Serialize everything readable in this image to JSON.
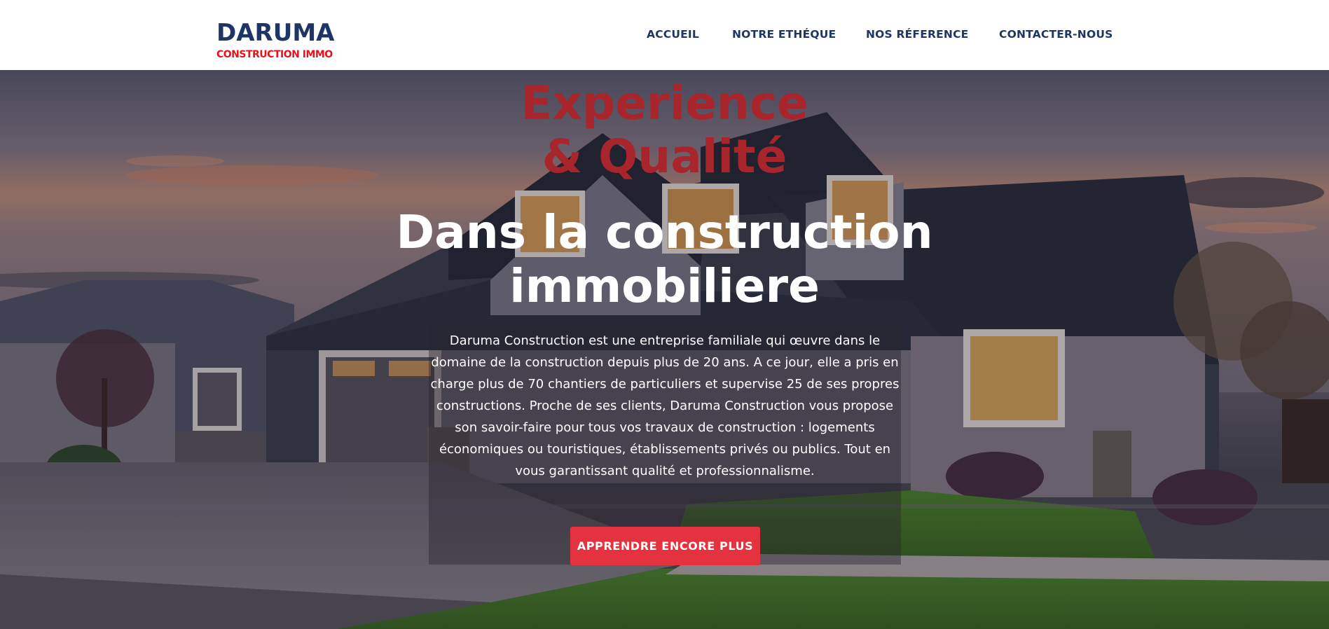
{
  "logo": {
    "name": "DARUMA",
    "tagline": "CONSTRUCTION IMMO"
  },
  "nav": {
    "items": [
      {
        "label": "ACCUEIL"
      },
      {
        "label": "NOTRE ETHÉQUE"
      },
      {
        "label": "NOS RÉFERENCE"
      },
      {
        "label": "CONTACTER-NOUS"
      }
    ]
  },
  "hero": {
    "headline_red": [
      "Experience",
      "& Qualité"
    ],
    "headline_white": [
      "Dans la construction",
      "immobiliere"
    ],
    "description": "Daruma Construction est une entreprise familiale qui œuvre dans le domaine de la construction depuis plus de 20 ans. A ce jour, elle a pris en charge plus de 70 chantiers de particuliers et supervise 25 de ses propres constructions. Proche de ses clients, Daruma Construction vous propose son savoir-faire pour tous vos travaux de construction : logements économiques ou touristiques, établissements privés ou publics. Tout en vous garantissant qualité et professionnalisme.",
    "cta_label": "APPRENDRE ENCORE PLUS"
  },
  "colors": {
    "brand_navy": "#1f3566",
    "brand_red": "#e8101c",
    "headline_red": "#a8262b",
    "cta_red": "#e4323f"
  }
}
